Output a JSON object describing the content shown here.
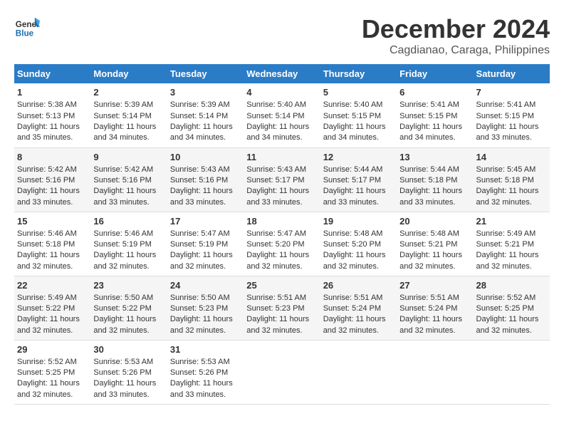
{
  "logo": {
    "line1": "General",
    "line2": "Blue"
  },
  "title": "December 2024",
  "subtitle": "Cagdianao, Caraga, Philippines",
  "days_of_week": [
    "Sunday",
    "Monday",
    "Tuesday",
    "Wednesday",
    "Thursday",
    "Friday",
    "Saturday"
  ],
  "weeks": [
    [
      {
        "day": "1",
        "sunrise": "Sunrise: 5:38 AM",
        "sunset": "Sunset: 5:13 PM",
        "daylight": "Daylight: 11 hours and 35 minutes."
      },
      {
        "day": "2",
        "sunrise": "Sunrise: 5:39 AM",
        "sunset": "Sunset: 5:14 PM",
        "daylight": "Daylight: 11 hours and 34 minutes."
      },
      {
        "day": "3",
        "sunrise": "Sunrise: 5:39 AM",
        "sunset": "Sunset: 5:14 PM",
        "daylight": "Daylight: 11 hours and 34 minutes."
      },
      {
        "day": "4",
        "sunrise": "Sunrise: 5:40 AM",
        "sunset": "Sunset: 5:14 PM",
        "daylight": "Daylight: 11 hours and 34 minutes."
      },
      {
        "day": "5",
        "sunrise": "Sunrise: 5:40 AM",
        "sunset": "Sunset: 5:15 PM",
        "daylight": "Daylight: 11 hours and 34 minutes."
      },
      {
        "day": "6",
        "sunrise": "Sunrise: 5:41 AM",
        "sunset": "Sunset: 5:15 PM",
        "daylight": "Daylight: 11 hours and 34 minutes."
      },
      {
        "day": "7",
        "sunrise": "Sunrise: 5:41 AM",
        "sunset": "Sunset: 5:15 PM",
        "daylight": "Daylight: 11 hours and 33 minutes."
      }
    ],
    [
      {
        "day": "8",
        "sunrise": "Sunrise: 5:42 AM",
        "sunset": "Sunset: 5:16 PM",
        "daylight": "Daylight: 11 hours and 33 minutes."
      },
      {
        "day": "9",
        "sunrise": "Sunrise: 5:42 AM",
        "sunset": "Sunset: 5:16 PM",
        "daylight": "Daylight: 11 hours and 33 minutes."
      },
      {
        "day": "10",
        "sunrise": "Sunrise: 5:43 AM",
        "sunset": "Sunset: 5:16 PM",
        "daylight": "Daylight: 11 hours and 33 minutes."
      },
      {
        "day": "11",
        "sunrise": "Sunrise: 5:43 AM",
        "sunset": "Sunset: 5:17 PM",
        "daylight": "Daylight: 11 hours and 33 minutes."
      },
      {
        "day": "12",
        "sunrise": "Sunrise: 5:44 AM",
        "sunset": "Sunset: 5:17 PM",
        "daylight": "Daylight: 11 hours and 33 minutes."
      },
      {
        "day": "13",
        "sunrise": "Sunrise: 5:44 AM",
        "sunset": "Sunset: 5:18 PM",
        "daylight": "Daylight: 11 hours and 33 minutes."
      },
      {
        "day": "14",
        "sunrise": "Sunrise: 5:45 AM",
        "sunset": "Sunset: 5:18 PM",
        "daylight": "Daylight: 11 hours and 32 minutes."
      }
    ],
    [
      {
        "day": "15",
        "sunrise": "Sunrise: 5:46 AM",
        "sunset": "Sunset: 5:18 PM",
        "daylight": "Daylight: 11 hours and 32 minutes."
      },
      {
        "day": "16",
        "sunrise": "Sunrise: 5:46 AM",
        "sunset": "Sunset: 5:19 PM",
        "daylight": "Daylight: 11 hours and 32 minutes."
      },
      {
        "day": "17",
        "sunrise": "Sunrise: 5:47 AM",
        "sunset": "Sunset: 5:19 PM",
        "daylight": "Daylight: 11 hours and 32 minutes."
      },
      {
        "day": "18",
        "sunrise": "Sunrise: 5:47 AM",
        "sunset": "Sunset: 5:20 PM",
        "daylight": "Daylight: 11 hours and 32 minutes."
      },
      {
        "day": "19",
        "sunrise": "Sunrise: 5:48 AM",
        "sunset": "Sunset: 5:20 PM",
        "daylight": "Daylight: 11 hours and 32 minutes."
      },
      {
        "day": "20",
        "sunrise": "Sunrise: 5:48 AM",
        "sunset": "Sunset: 5:21 PM",
        "daylight": "Daylight: 11 hours and 32 minutes."
      },
      {
        "day": "21",
        "sunrise": "Sunrise: 5:49 AM",
        "sunset": "Sunset: 5:21 PM",
        "daylight": "Daylight: 11 hours and 32 minutes."
      }
    ],
    [
      {
        "day": "22",
        "sunrise": "Sunrise: 5:49 AM",
        "sunset": "Sunset: 5:22 PM",
        "daylight": "Daylight: 11 hours and 32 minutes."
      },
      {
        "day": "23",
        "sunrise": "Sunrise: 5:50 AM",
        "sunset": "Sunset: 5:22 PM",
        "daylight": "Daylight: 11 hours and 32 minutes."
      },
      {
        "day": "24",
        "sunrise": "Sunrise: 5:50 AM",
        "sunset": "Sunset: 5:23 PM",
        "daylight": "Daylight: 11 hours and 32 minutes."
      },
      {
        "day": "25",
        "sunrise": "Sunrise: 5:51 AM",
        "sunset": "Sunset: 5:23 PM",
        "daylight": "Daylight: 11 hours and 32 minutes."
      },
      {
        "day": "26",
        "sunrise": "Sunrise: 5:51 AM",
        "sunset": "Sunset: 5:24 PM",
        "daylight": "Daylight: 11 hours and 32 minutes."
      },
      {
        "day": "27",
        "sunrise": "Sunrise: 5:51 AM",
        "sunset": "Sunset: 5:24 PM",
        "daylight": "Daylight: 11 hours and 32 minutes."
      },
      {
        "day": "28",
        "sunrise": "Sunrise: 5:52 AM",
        "sunset": "Sunset: 5:25 PM",
        "daylight": "Daylight: 11 hours and 32 minutes."
      }
    ],
    [
      {
        "day": "29",
        "sunrise": "Sunrise: 5:52 AM",
        "sunset": "Sunset: 5:25 PM",
        "daylight": "Daylight: 11 hours and 32 minutes."
      },
      {
        "day": "30",
        "sunrise": "Sunrise: 5:53 AM",
        "sunset": "Sunset: 5:26 PM",
        "daylight": "Daylight: 11 hours and 33 minutes."
      },
      {
        "day": "31",
        "sunrise": "Sunrise: 5:53 AM",
        "sunset": "Sunset: 5:26 PM",
        "daylight": "Daylight: 11 hours and 33 minutes."
      },
      {
        "day": "",
        "sunrise": "",
        "sunset": "",
        "daylight": ""
      },
      {
        "day": "",
        "sunrise": "",
        "sunset": "",
        "daylight": ""
      },
      {
        "day": "",
        "sunrise": "",
        "sunset": "",
        "daylight": ""
      },
      {
        "day": "",
        "sunrise": "",
        "sunset": "",
        "daylight": ""
      }
    ]
  ]
}
